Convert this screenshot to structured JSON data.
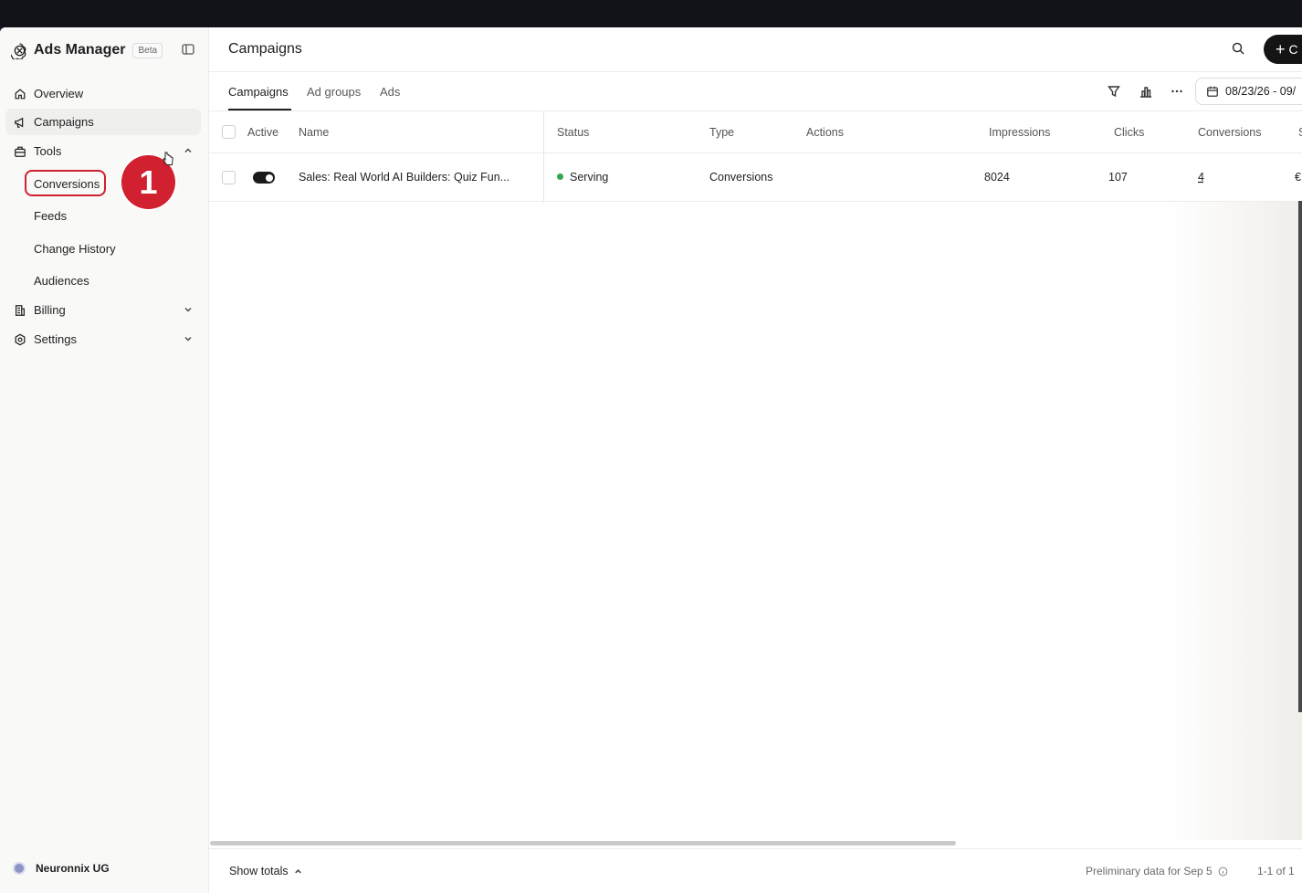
{
  "colors": {
    "accent_red": "#d1202f",
    "serving_green": "#2fa84f",
    "primary_button": "#141414"
  },
  "sidebar": {
    "brand": "Ads Manager",
    "beta": "Beta",
    "nav": {
      "overview": "Overview",
      "campaigns": "Campaigns",
      "tools": "Tools",
      "conversions": "Conversions",
      "feeds": "Feeds",
      "change_history": "Change History",
      "audiences": "Audiences",
      "billing": "Billing",
      "settings": "Settings"
    },
    "org_name": "Neuronnix UG",
    "step_badge": "1"
  },
  "header": {
    "title": "Campaigns",
    "create_label": "C",
    "tabs": [
      "Campaigns",
      "Ad groups",
      "Ads"
    ],
    "date_range": "08/23/26 - 09/"
  },
  "table": {
    "columns": [
      "Active",
      "Name",
      "Status",
      "Type",
      "Actions",
      "Impressions",
      "Clicks",
      "Conversions",
      "S"
    ],
    "rows": [
      {
        "active": true,
        "name": "Sales: Real World AI Builders: Quiz Fun...",
        "status": "Serving",
        "type": "Conversions",
        "actions": "",
        "impressions": "8024",
        "clicks": "107",
        "conversions": "4",
        "spend": "€"
      }
    ]
  },
  "footer": {
    "show_totals": "Show totals",
    "preliminary": "Preliminary data for Sep 5",
    "pagination": "1-1 of 1"
  }
}
